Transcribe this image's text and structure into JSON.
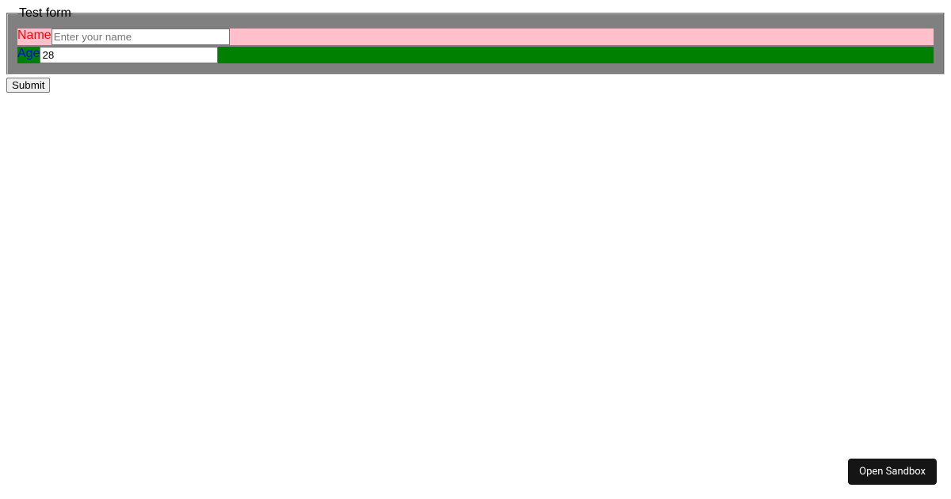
{
  "form": {
    "legend": "Test form",
    "fields": {
      "name": {
        "label": "Name",
        "placeholder": "Enter your name",
        "value": ""
      },
      "age": {
        "label": "Age",
        "placeholder": "",
        "value": "28"
      }
    },
    "submit_label": "Submit"
  },
  "sandbox": {
    "open_label": "Open Sandbox"
  },
  "colors": {
    "fieldset_bg": "#808080",
    "name_row_bg": "#ffc0cb",
    "age_row_bg": "#008000",
    "name_label_color": "#ff0000",
    "age_label_color": "#0000ff"
  }
}
